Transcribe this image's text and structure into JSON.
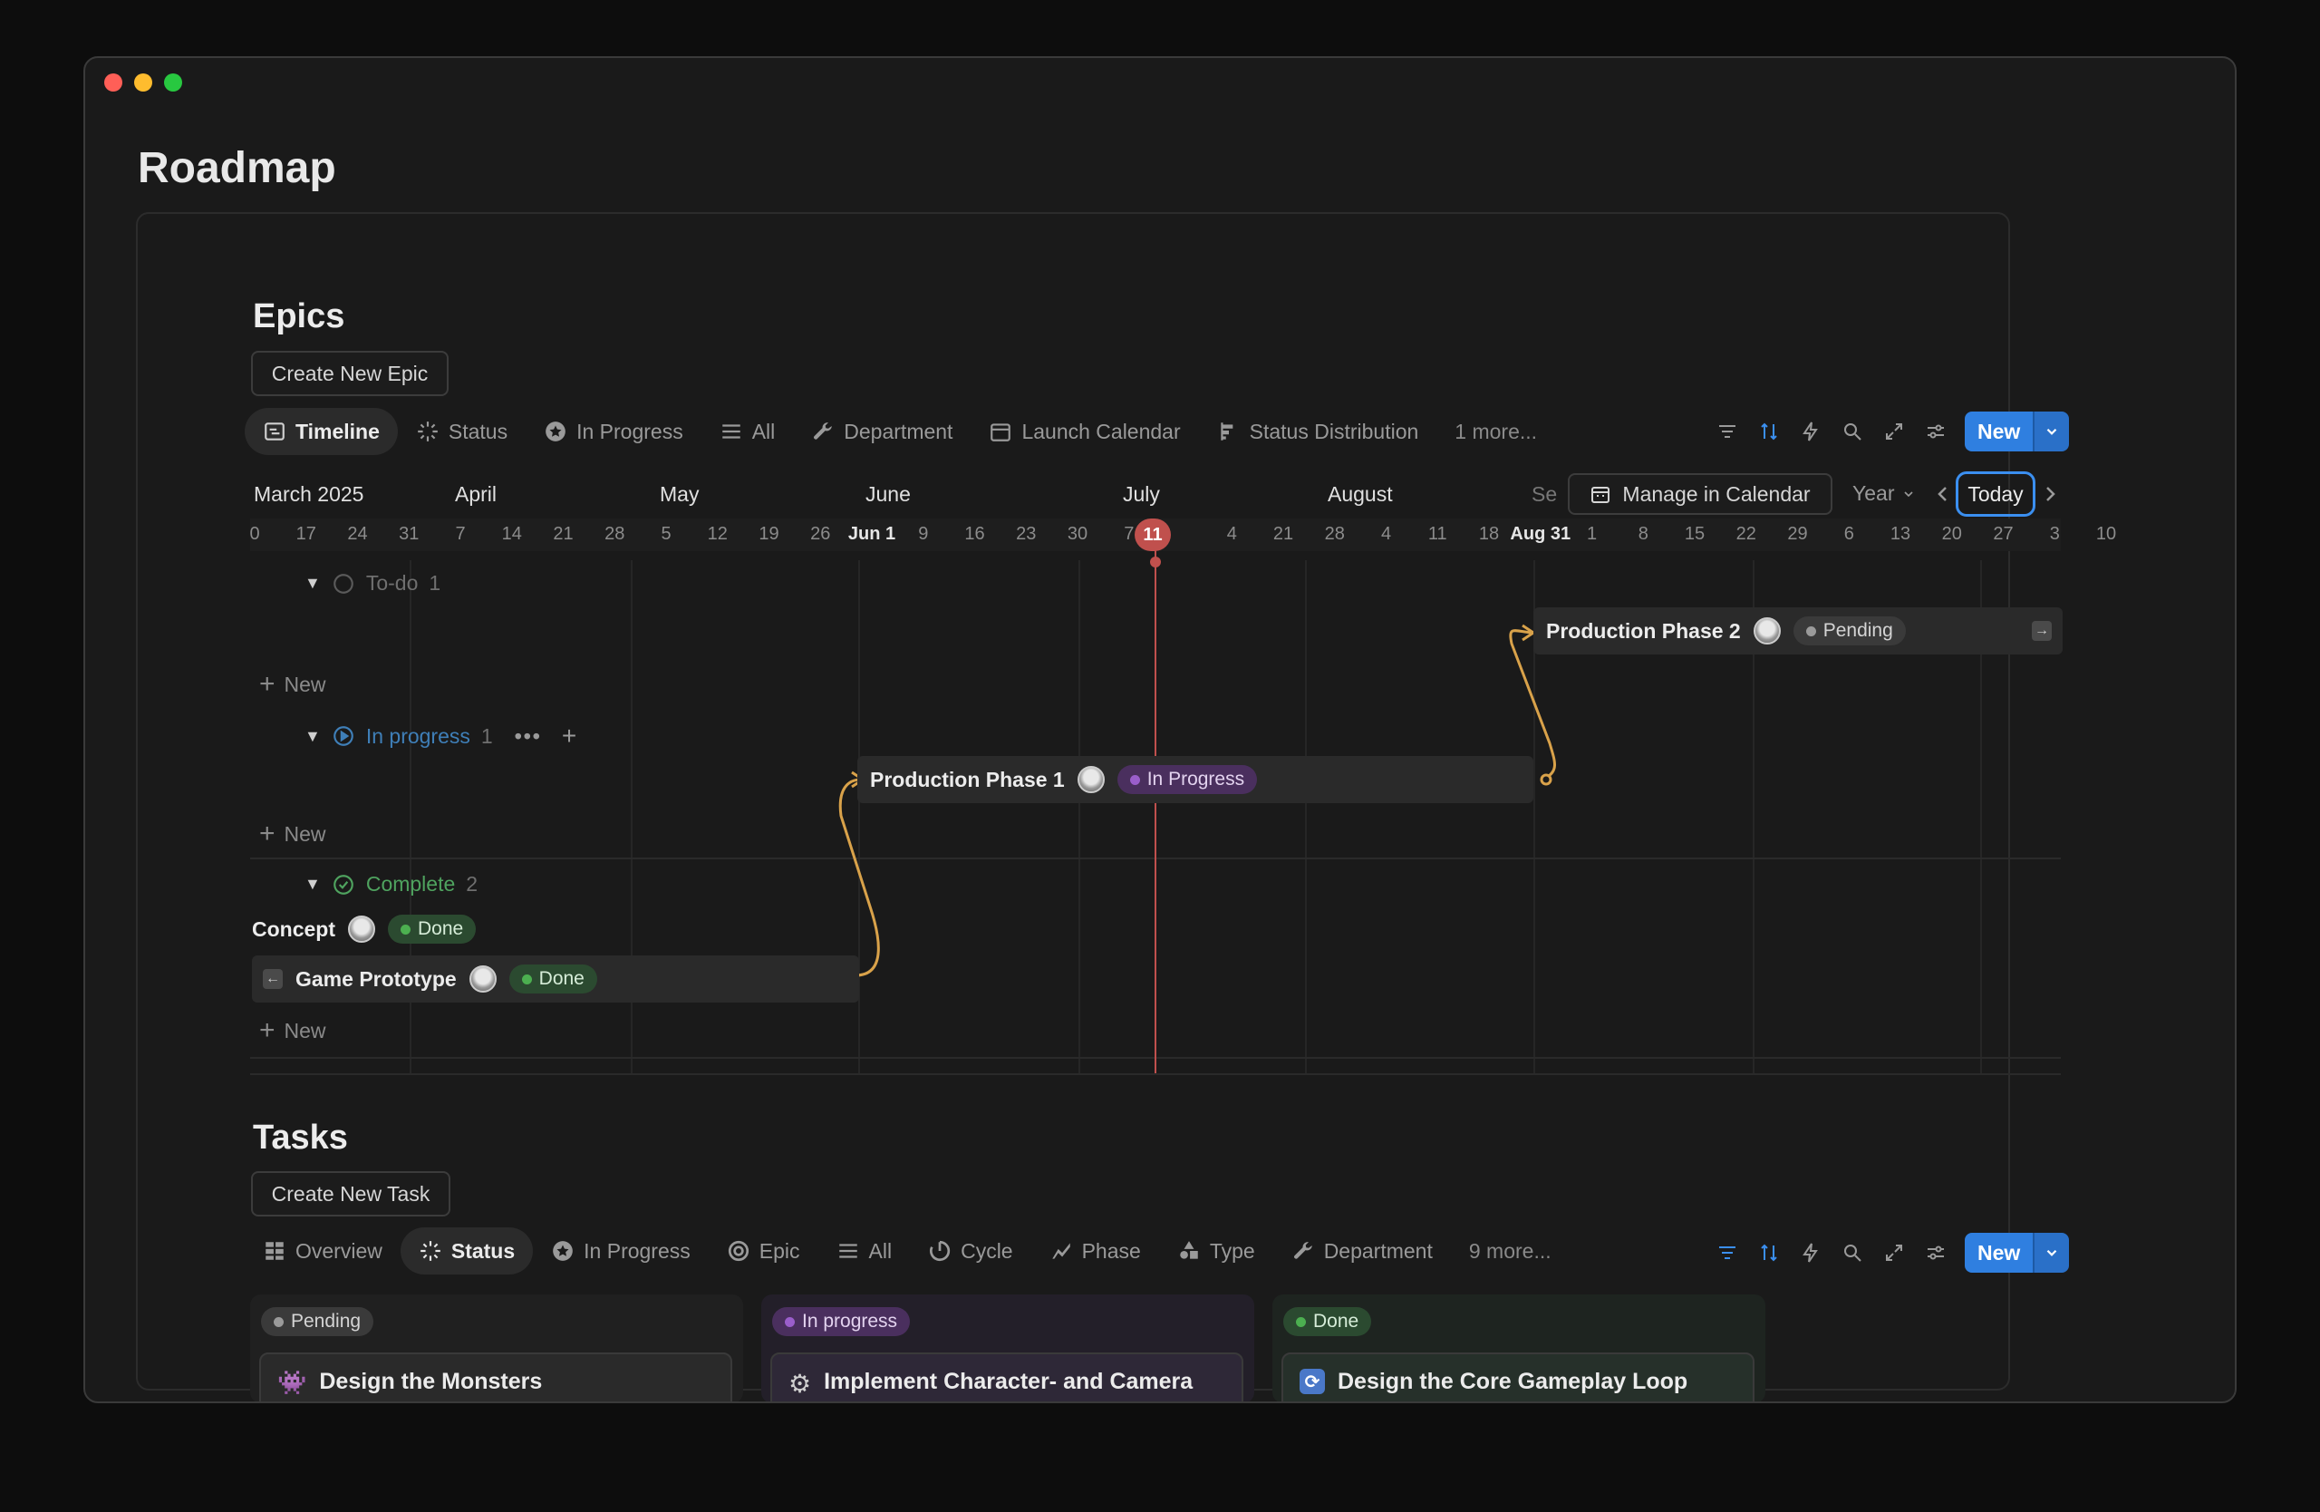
{
  "page": {
    "title": "Roadmap"
  },
  "epics": {
    "title": "Epics",
    "create_button": "Create New Epic",
    "tabs": [
      {
        "label": "Timeline",
        "icon": "timeline-icon",
        "active": true
      },
      {
        "label": "Status",
        "icon": "status-icon"
      },
      {
        "label": "In Progress",
        "icon": "star-circle-icon"
      },
      {
        "label": "All",
        "icon": "list-icon"
      },
      {
        "label": "Department",
        "icon": "wrench-icon"
      },
      {
        "label": "Launch Calendar",
        "icon": "calendar-icon"
      },
      {
        "label": "Status Distribution",
        "icon": "bar-chart-icon"
      }
    ],
    "more_tabs": "1 more...",
    "new_button": "New",
    "timeline": {
      "months": [
        "March 2025",
        "April",
        "May",
        "June",
        "July",
        "August",
        "Se"
      ],
      "days": [
        "0",
        "17",
        "24",
        "31",
        "7",
        "14",
        "21",
        "28",
        "5",
        "12",
        "19",
        "26",
        "Jun 1",
        "9",
        "16",
        "23",
        "30",
        "7",
        "11",
        "4",
        "21",
        "28",
        "4",
        "11",
        "18",
        "Aug 31",
        "1",
        "8",
        "15",
        "22",
        "29",
        "6",
        "13",
        "20",
        "27",
        "3",
        "10"
      ],
      "today_marker": "11",
      "manage_calendar": "Manage in Calendar",
      "scale": "Year",
      "today_button": "Today"
    },
    "groups": [
      {
        "label": "To-do",
        "count": "1",
        "color": "#6f6f6f"
      },
      {
        "label": "In progress",
        "count": "1",
        "color": "#3f7fb8"
      },
      {
        "label": "Complete",
        "count": "2",
        "color": "#4fa35f"
      }
    ],
    "new_row_label": "New",
    "bars": {
      "phase2": {
        "title": "Production Phase 2",
        "status": "Pending"
      },
      "phase1": {
        "title": "Production Phase 1",
        "status": "In Progress"
      },
      "concept": {
        "title": "Concept",
        "status": "Done"
      },
      "prototype": {
        "title": "Game Prototype",
        "status": "Done"
      }
    }
  },
  "tasks": {
    "title": "Tasks",
    "create_button": "Create New Task",
    "tabs": [
      {
        "label": "Overview",
        "icon": "grid-icon"
      },
      {
        "label": "Status",
        "icon": "status-icon",
        "active": true
      },
      {
        "label": "In Progress",
        "icon": "star-circle-icon"
      },
      {
        "label": "Epic",
        "icon": "target-icon"
      },
      {
        "label": "All",
        "icon": "list-icon"
      },
      {
        "label": "Cycle",
        "icon": "cycle-icon"
      },
      {
        "label": "Phase",
        "icon": "phase-icon"
      },
      {
        "label": "Type",
        "icon": "shapes-icon"
      },
      {
        "label": "Department",
        "icon": "wrench-icon"
      }
    ],
    "more_tabs": "9 more...",
    "new_button": "New",
    "columns": [
      {
        "status": "Pending",
        "card": "Design the Monsters",
        "icon": "monster-icon"
      },
      {
        "status": "In progress",
        "card": "Implement Character- and Camera",
        "icon": "gear-icon"
      },
      {
        "status": "Done",
        "card": "Design the Core Gameplay Loop",
        "icon": "loop-icon"
      }
    ]
  },
  "colors": {
    "accent": "#2f7fe0",
    "today": "#c0504d",
    "dependency": "#d9a24a"
  }
}
